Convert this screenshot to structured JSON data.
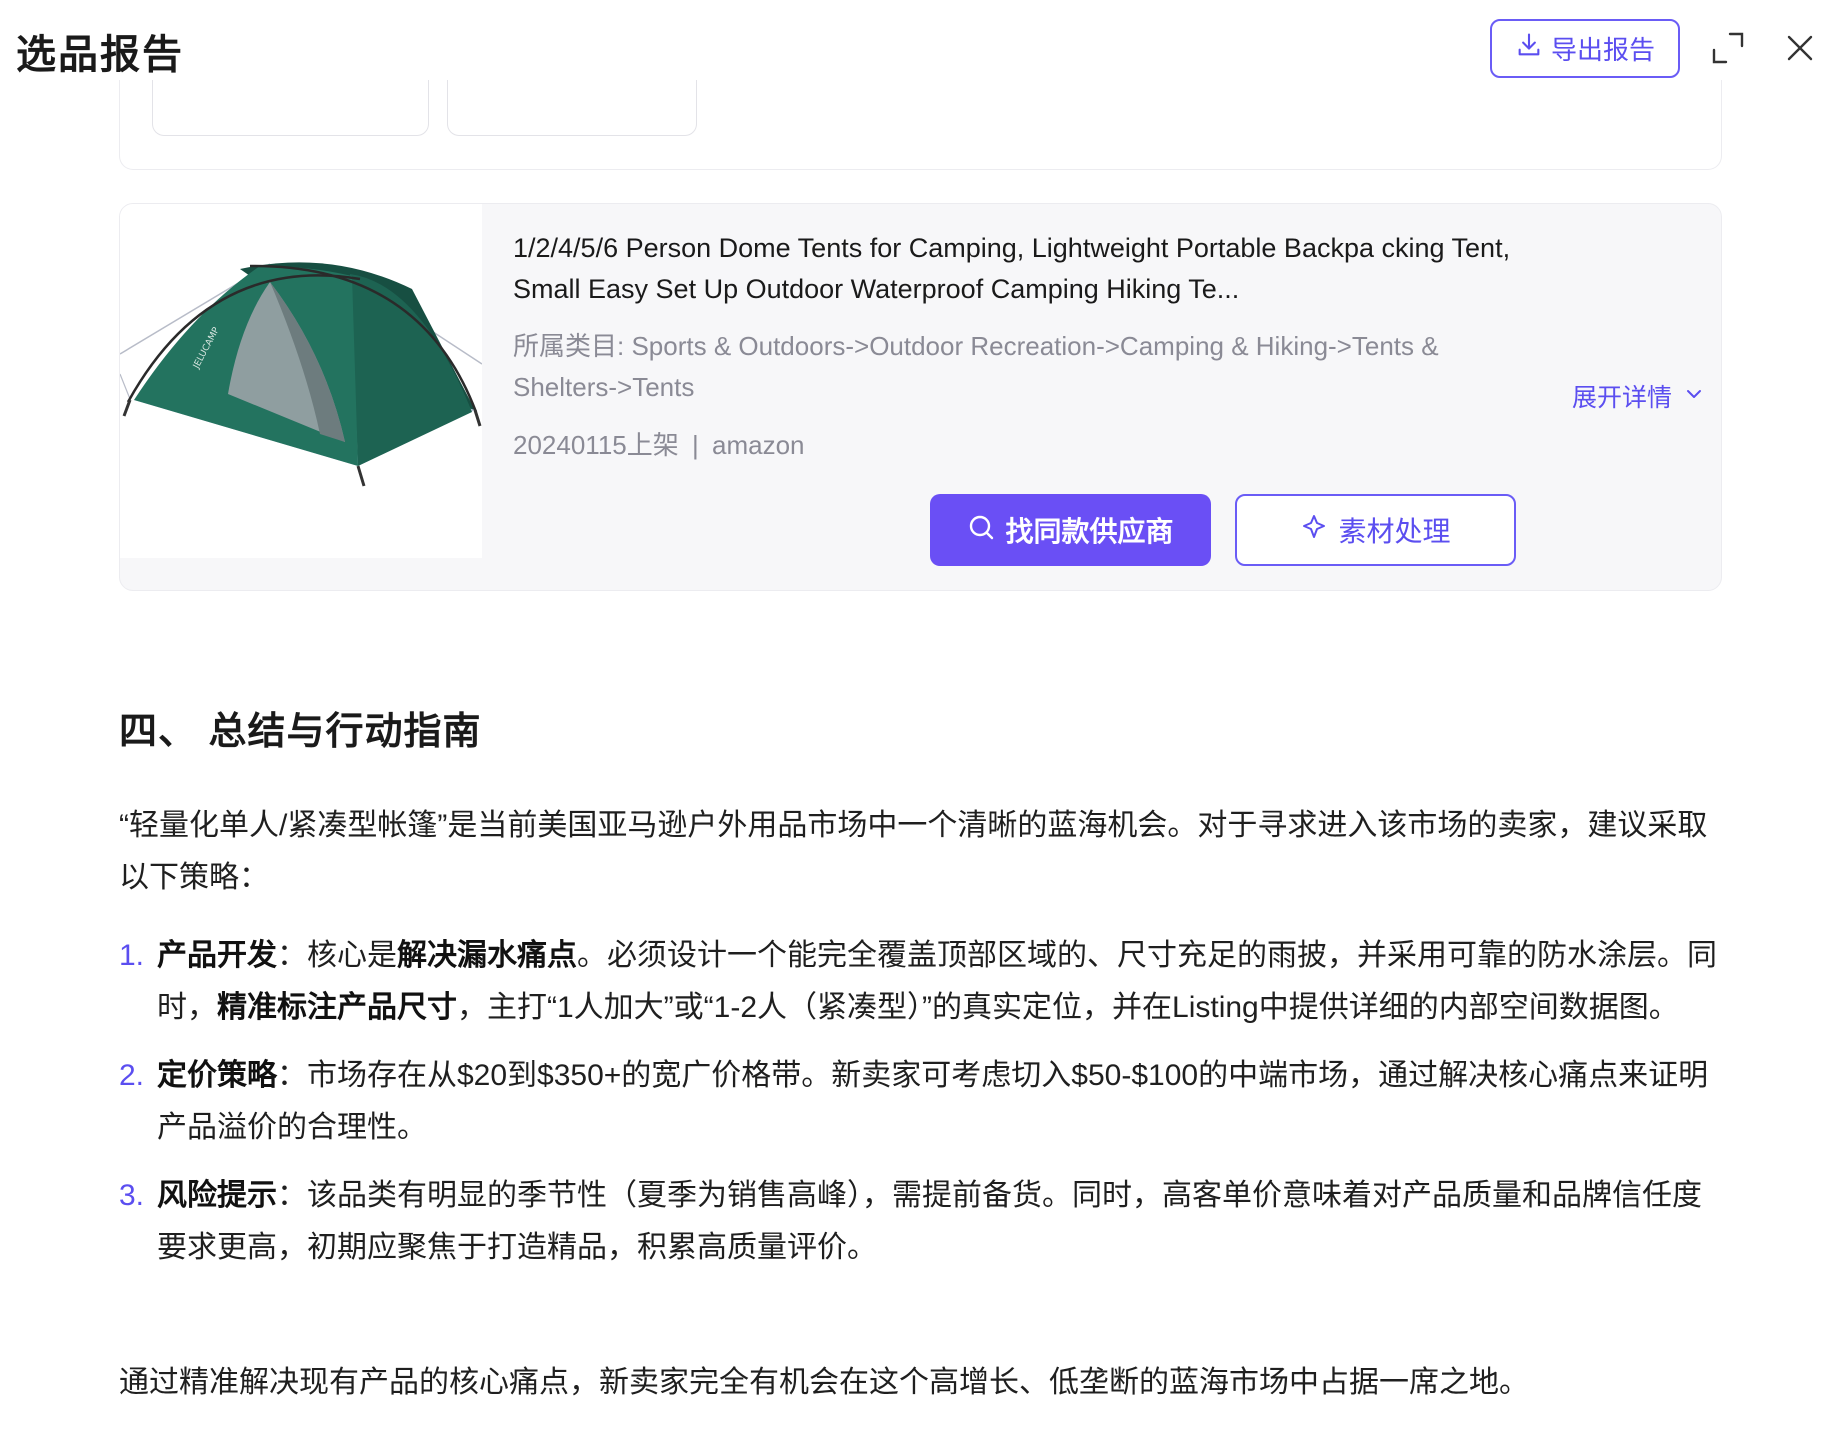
{
  "header": {
    "title": "选品报告",
    "export_label": "导出报告"
  },
  "product": {
    "title": "1/2/4/5/6 Person Dome Tents for Camping, Lightweight Portable Backpa cking Tent, Small Easy Set Up Outdoor Waterproof Camping Hiking Te...",
    "category_label": "所属类目:",
    "category_path": "Sports & Outdoors->Outdoor Recreation->Camping & Hiking->Tents & Shelters->Tents",
    "listing_date": "20240115上架",
    "separator": "|",
    "platform": "amazon",
    "expand_label": "展开详情",
    "find_supplier_label": "找同款供应商",
    "material_label": "素材处理",
    "image_brand_text": "JELUCAMP"
  },
  "section": {
    "heading": "四、 总结与行动指南",
    "intro": "“轻量化单人/紧凑型帐篷”是当前美国亚马逊户外用品市场中一个清晰的蓝海机会。对于寻求进入该市场的卖家，建议采取以下策略：",
    "items": [
      {
        "num": "1.",
        "label": "产品开发",
        "colon": "：",
        "p1": "核心是",
        "b1": "解决漏水痛点",
        "p2": "。必须设计一个能完全覆盖顶部区域的、尺寸充足的雨披，并采用可靠的防水涂层。同时，",
        "b2": "精准标注产品尺寸",
        "p3": "，主打“1人加大”或“1-2人（紧凑型）”的真实定位，并在Listing中提供详细的内部空间数据图。"
      },
      {
        "num": "2.",
        "label": "定价策略",
        "colon": "：",
        "text": "市场存在从$20到$350+的宽广价格带。新卖家可考虑切入$50-$100的中端市场，通过解决核心痛点来证明产品溢价的合理性。"
      },
      {
        "num": "3.",
        "label": "风险提示",
        "colon": "：",
        "text": "该品类有明显的季节性（夏季为销售高峰），需提前备货。同时，高客单价意味着对产品质量和品牌信任度要求更高，初期应聚焦于打造精品，积累高质量评价。"
      }
    ],
    "conclusion": "通过精准解决现有产品的核心痛点，新卖家完全有机会在这个高增长、低垄断的蓝海市场中占据一席之地。"
  },
  "colors": {
    "accent": "#6a4ff5",
    "accent_text": "#5b4ef0",
    "muted_text": "#8a8a95",
    "tent_green": "#1f6b58",
    "card_bg": "#f7f7f9"
  },
  "icons": [
    "download-icon",
    "expand-icon",
    "close-icon",
    "chevron-down-icon",
    "search-icon",
    "sparkle-icon"
  ]
}
